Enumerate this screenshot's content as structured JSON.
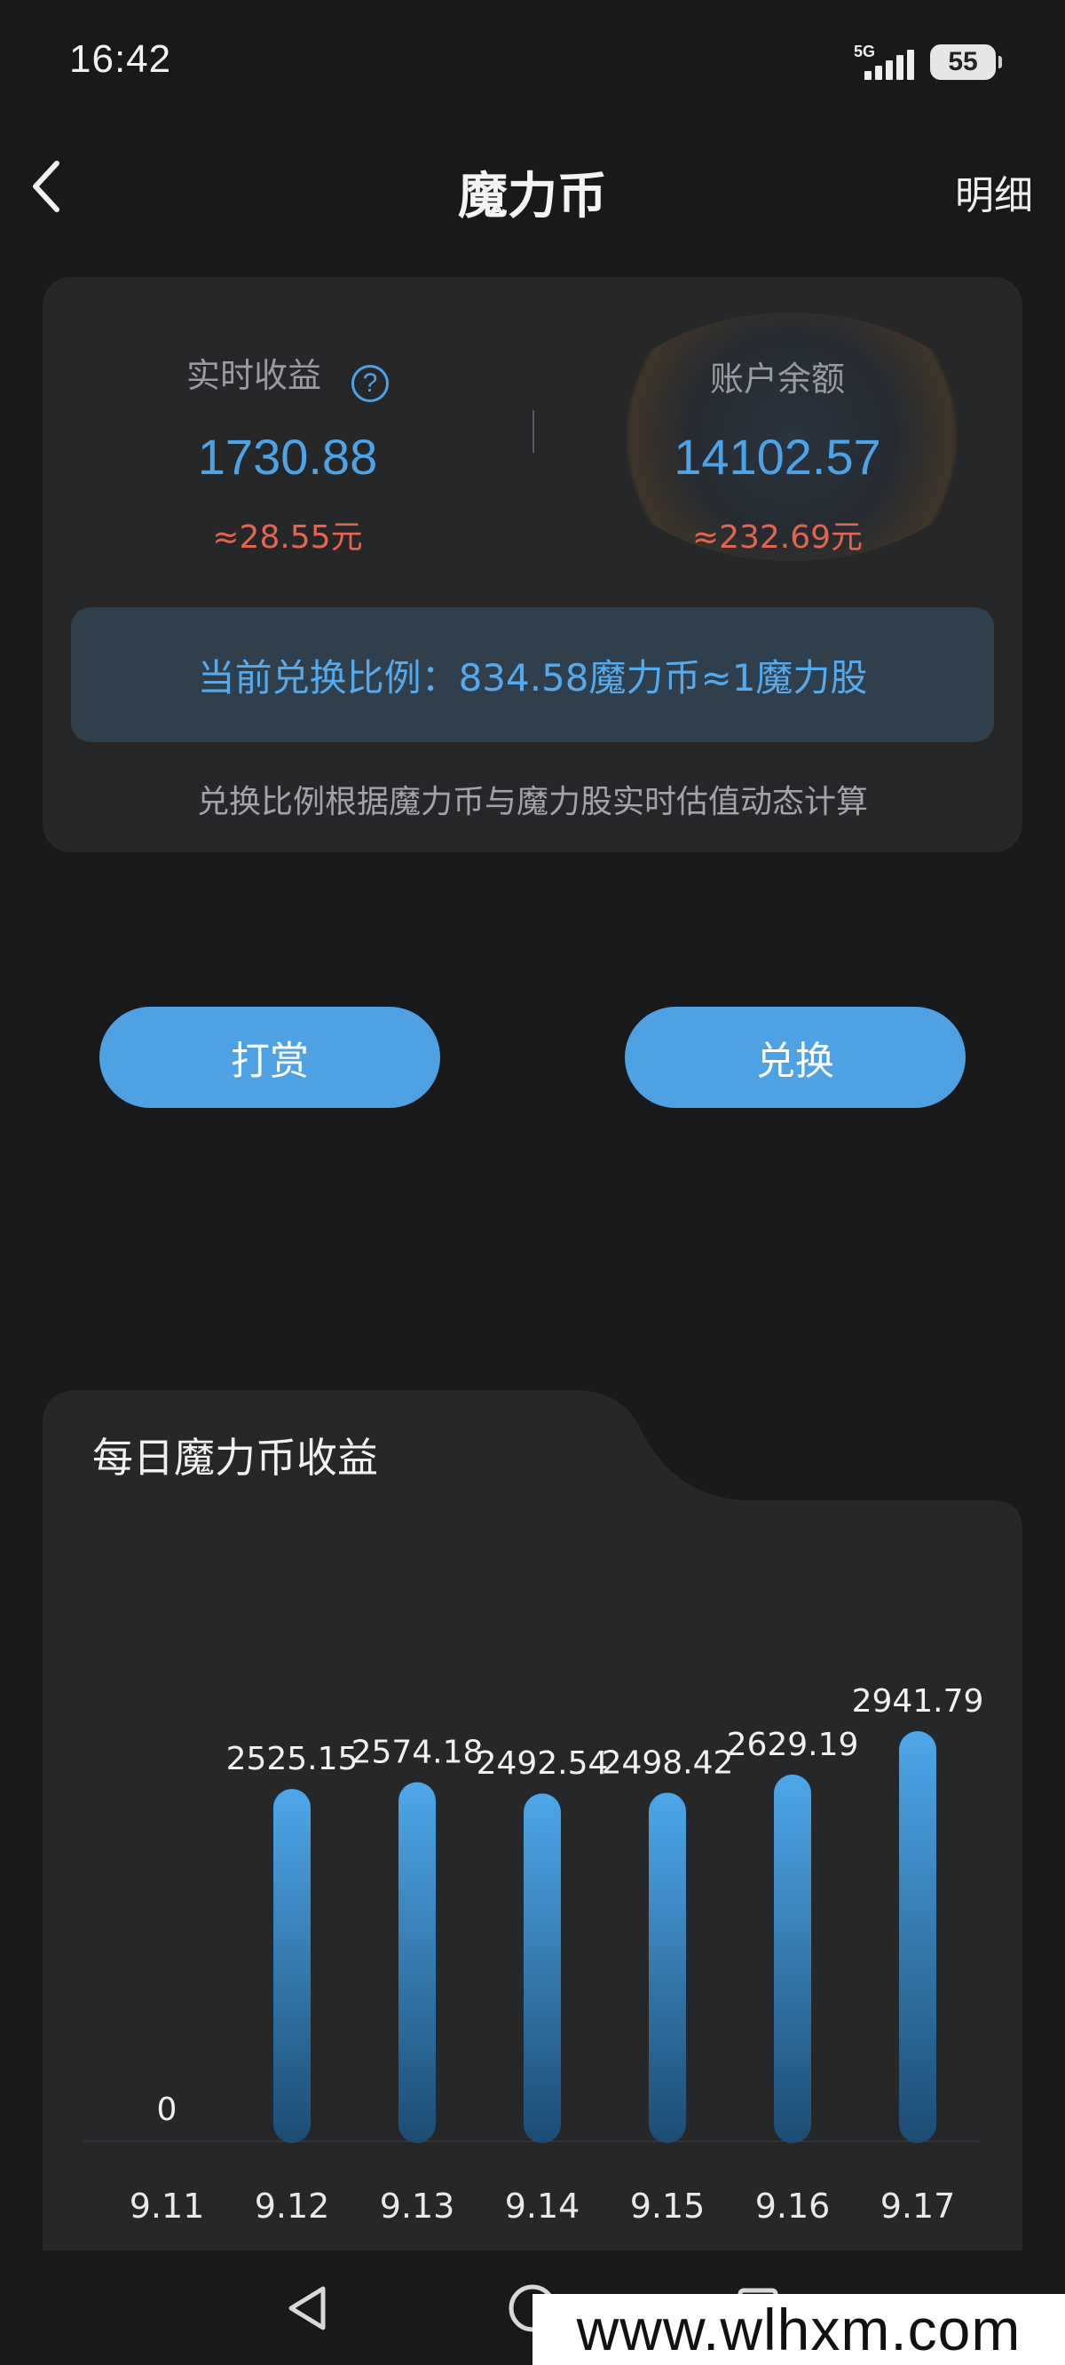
{
  "status": {
    "time": "16:42",
    "network": "5G",
    "battery": "55"
  },
  "header": {
    "title": "魔力币",
    "detail": "明细"
  },
  "summary": {
    "realtime_label": "实时收益",
    "realtime_value": "1730.88",
    "realtime_approx": "≈28.55元",
    "balance_label": "账户余额",
    "balance_value": "14102.57",
    "balance_approx": "≈232.69元",
    "rate_text": "当前兑换比例：834.58魔力币≈1魔力股",
    "rate_note": "兑换比例根据魔力币与魔力股实时估值动态计算"
  },
  "actions": {
    "tip_label": "打赏",
    "exchange_label": "兑换"
  },
  "chart_title": "每日魔力币收益",
  "chart_data": {
    "type": "bar",
    "title": "每日魔力币收益",
    "categories": [
      "9.11",
      "9.12",
      "9.13",
      "9.14",
      "9.15",
      "9.16",
      "9.17"
    ],
    "values": [
      0,
      2525.15,
      2574.18,
      2492.54,
      2498.42,
      2629.19,
      2941.79
    ],
    "value_labels": [
      "0",
      "2525.15",
      "2574.18",
      "2492.54",
      "2498.42",
      "2629.19",
      "2941.79"
    ],
    "ylim": [
      0,
      2941.79
    ],
    "grid": false,
    "colors": {
      "bar_top": "#4ea7ea",
      "bar_bottom": "#1c4c73"
    }
  },
  "watermark_text": "www.wlhxm.com",
  "theme": {
    "accent": "#4ea2e4",
    "approx": "#e4654f",
    "background": "#18191b",
    "card": "#262729"
  }
}
